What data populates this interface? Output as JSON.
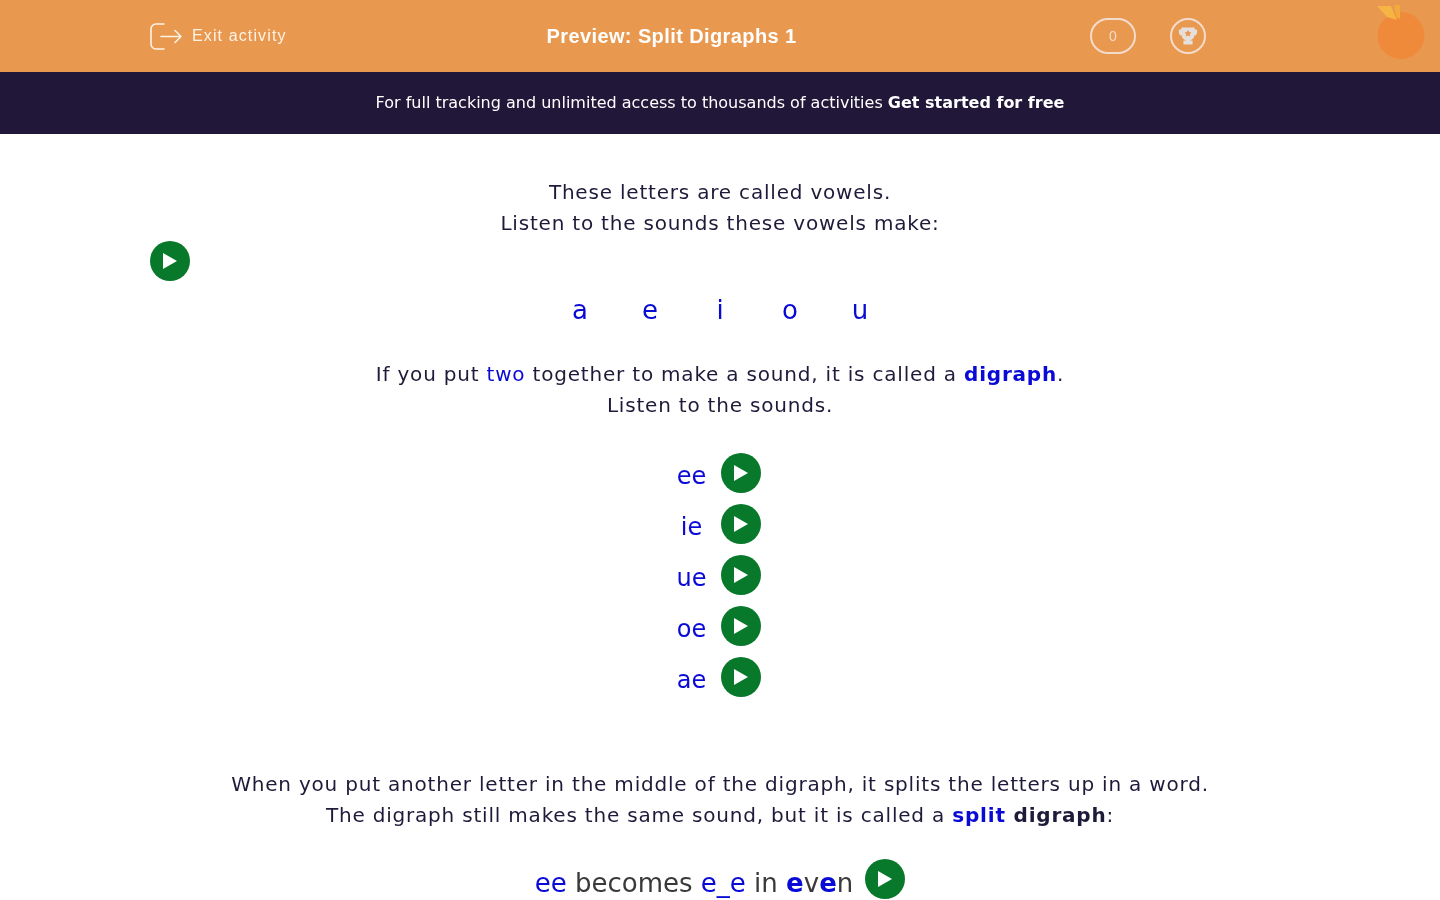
{
  "header": {
    "exit_label": "Exit activity",
    "title": "Preview: Split Digraphs 1",
    "score": "0"
  },
  "banner": {
    "text": "For full tracking and unlimited access to thousands of activities",
    "link": "Get started for free"
  },
  "vowel_intro": [
    "These letters are called vowels.",
    "Listen to the sounds these vowels make:"
  ],
  "vowels": [
    "a",
    "e",
    "i",
    "o",
    "u"
  ],
  "digraph_intro": [
    [
      {
        "text": "If you put ",
        "kind": "plain"
      },
      {
        "text": "two",
        "kind": "key"
      },
      {
        "text": " together to make a sound, it is called a ",
        "kind": "plain"
      },
      {
        "text": "digraph",
        "kind": "key_bold"
      },
      {
        "text": ".",
        "kind": "plain"
      }
    ],
    [
      {
        "text": "Listen to the sounds.",
        "kind": "plain"
      }
    ]
  ],
  "digraphs": [
    "ee",
    "ie",
    "ue",
    "oe",
    "ae"
  ],
  "split_intro": [
    [
      {
        "text": "When you put another letter in the middle of the digraph, it splits the letters up in a word.",
        "kind": "plain"
      }
    ],
    [
      {
        "text": "The digraph still makes the same sound, but it is called a ",
        "kind": "plain"
      },
      {
        "text": "split",
        "kind": "key_bold"
      },
      {
        "text": " digraph",
        "kind": "bold"
      },
      {
        "text": ":",
        "kind": "plain"
      }
    ]
  ],
  "example": [
    {
      "text": "ee",
      "kind": "key"
    },
    {
      "text": " becomes ",
      "kind": "plain"
    },
    {
      "text": "e_e",
      "kind": "key"
    },
    {
      "text": " in ",
      "kind": "plain"
    },
    {
      "text": "e",
      "kind": "key_bold"
    },
    {
      "text": "v",
      "kind": "plain"
    },
    {
      "text": "e",
      "kind": "key_bold"
    },
    {
      "text": "n",
      "kind": "plain"
    }
  ]
}
